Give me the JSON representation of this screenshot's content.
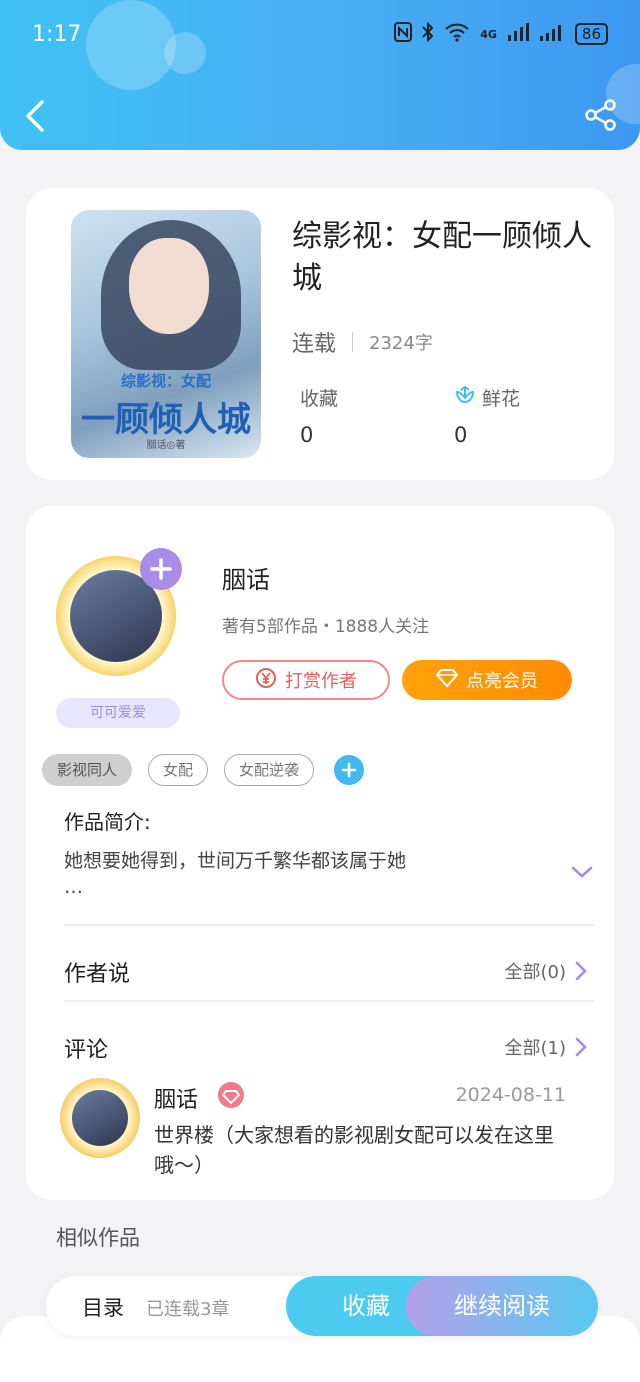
{
  "status_bar": {
    "time": "1:17",
    "network": "4G",
    "battery": "86"
  },
  "book": {
    "title": "综影视：女配一顾倾人城",
    "status": "连载",
    "word_count": "2324字",
    "favorites_label": "收藏",
    "favorites_count": "0",
    "flowers_label": "鲜花",
    "flowers_count": "0",
    "cover": {
      "title_small": "综影视：女配",
      "title_big": "一顾倾人城",
      "author_mark": "胭话◎著"
    }
  },
  "author": {
    "name": "胭话",
    "info": "著有5部作品・1888人关注",
    "badge": "可可爱爱",
    "tip_label": "打赏作者",
    "vip_label": "点亮会员"
  },
  "tags": [
    "影视同人",
    "女配",
    "女配逆袭"
  ],
  "intro": {
    "title": "作品简介:",
    "text": "她想要她得到，世间万千繁华都该属于她",
    "ellipsis": "…"
  },
  "author_says": {
    "title": "作者说",
    "all_label": "全部(0)"
  },
  "comments": {
    "title": "评论",
    "all_label": "全部(1)",
    "items": [
      {
        "name": "胭话",
        "date": "2024-08-11",
        "text": "世界楼（大家想看的影视剧女配可以发在这里哦～）"
      }
    ]
  },
  "similar_title": "相似作品",
  "bottom_bar": {
    "toc_label": "目录",
    "progress": "已连载3章",
    "favorite_label": "收藏",
    "continue_label": "继续阅读"
  },
  "colors": {
    "header_blue": "#48aef3",
    "vip_orange": "#ff9a08",
    "accent_purple": "#a98be8",
    "fav_cyan": "#4ccaf0"
  }
}
